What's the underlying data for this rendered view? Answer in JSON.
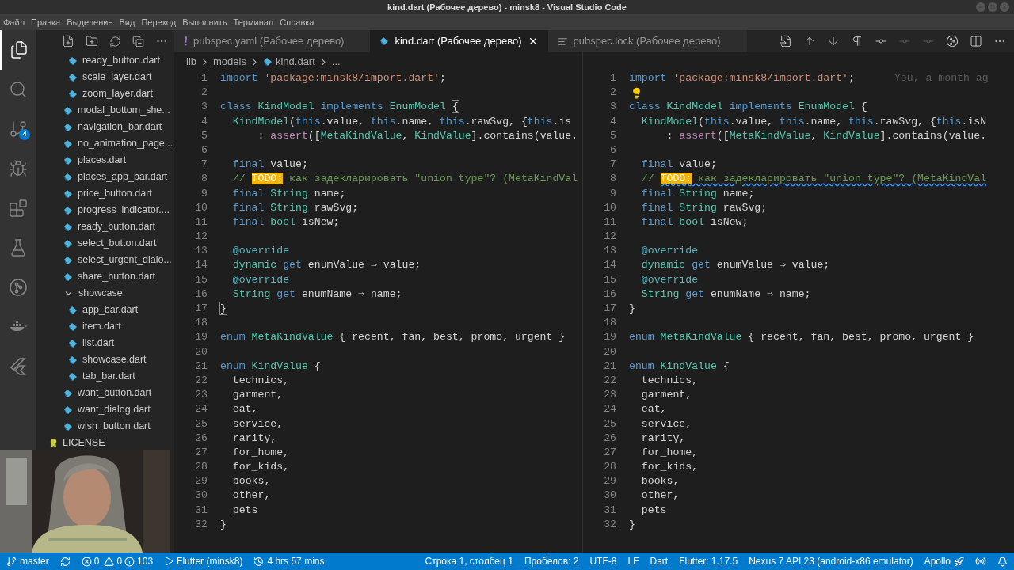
{
  "window": {
    "title": "kind.dart (Рабочее дерево) - minsk8 - Visual Studio Code"
  },
  "menu": [
    "Файл",
    "Правка",
    "Выделение",
    "Вид",
    "Переход",
    "Выполнить",
    "Терминал",
    "Справка"
  ],
  "activity_bar": [
    {
      "selected": true
    },
    {
      "selected": false
    },
    {
      "selected": false,
      "badge": "4"
    },
    {
      "selected": false
    },
    {
      "selected": false
    },
    {
      "selected": false
    },
    {
      "selected": false
    },
    {
      "selected": false
    },
    {
      "selected": false
    }
  ],
  "explorer": {
    "tree": [
      {
        "kind": "group",
        "children": [
          {
            "kind": "group",
            "children": [
              {
                "name": "ready_button.dart",
                "kind": "dart"
              },
              {
                "name": "scale_layer.dart",
                "kind": "dart"
              },
              {
                "name": "zoom_layer.dart",
                "kind": "dart"
              }
            ]
          },
          {
            "name": "modal_bottom_she...",
            "kind": "dart"
          },
          {
            "name": "navigation_bar.dart",
            "kind": "dart"
          },
          {
            "name": "no_animation_page...",
            "kind": "dart"
          },
          {
            "name": "places.dart",
            "kind": "dart"
          },
          {
            "name": "places_app_bar.dart",
            "kind": "dart"
          },
          {
            "name": "price_button.dart",
            "kind": "dart"
          },
          {
            "name": "progress_indicator....",
            "kind": "dart"
          },
          {
            "name": "ready_button.dart",
            "kind": "dart"
          },
          {
            "name": "select_button.dart",
            "kind": "dart"
          },
          {
            "name": "select_urgent_dialo...",
            "kind": "dart"
          },
          {
            "name": "share_button.dart",
            "kind": "dart"
          },
          {
            "name": "showcase",
            "kind": "folder",
            "expanded": true,
            "children": [
              {
                "name": "app_bar.dart",
                "kind": "dart"
              },
              {
                "name": "item.dart",
                "kind": "dart"
              },
              {
                "name": "list.dart",
                "kind": "dart"
              },
              {
                "name": "showcase.dart",
                "kind": "dart"
              },
              {
                "name": "tab_bar.dart",
                "kind": "dart"
              }
            ]
          },
          {
            "name": "want_button.dart",
            "kind": "dart"
          },
          {
            "name": "want_dialog.dart",
            "kind": "dart"
          },
          {
            "name": "wish_button.dart",
            "kind": "dart"
          }
        ]
      },
      {
        "name": "LICENSE",
        "kind": "license"
      }
    ]
  },
  "tabs": [
    {
      "label": "pubspec.yaml (Рабочее дерево)",
      "kind": "yaml",
      "selected": false
    },
    {
      "label": "kind.dart (Рабочее дерево)",
      "kind": "dart",
      "selected": true
    },
    {
      "label": "pubspec.lock (Рабочее дерево)",
      "kind": "lock",
      "selected": false
    }
  ],
  "editor_actions": [
    {
      "disabled": false
    },
    {
      "disabled": false
    },
    {
      "disabled": false
    },
    {
      "disabled": false
    },
    {
      "disabled": false
    },
    {
      "disabled": true
    },
    {
      "disabled": true
    },
    {
      "disabled": false
    },
    {
      "disabled": false
    },
    {
      "disabled": false
    }
  ],
  "breadcrumb": [
    {
      "kind": "folder",
      "text": "lib"
    },
    {
      "kind": "folder",
      "text": "models"
    },
    {
      "kind": "dart",
      "text": "kind.dart"
    },
    {
      "kind": "more",
      "text": "..."
    }
  ],
  "panes": [
    {
      "lines": [
        {
          "num": "1",
          "tokens": [
            {
              "kind": "kw",
              "text": "import"
            },
            {
              "kind": "str",
              "text": " 'package:minsk8/import.dart'"
            },
            {
              "kind": "plain",
              "text": ";"
            }
          ]
        },
        {
          "num": "2"
        },
        {
          "num": "3",
          "tokens": [
            {
              "kind": "kw",
              "text": "class"
            },
            {
              "kind": "type",
              "text": " KindModel"
            },
            {
              "kind": "kw",
              "text": " implements"
            },
            {
              "kind": "type",
              "text": " EnumModel "
            },
            {
              "kind": "bracket",
              "text": "{"
            }
          ]
        },
        {
          "num": "4",
          "tokens": [
            {
              "kind": "type",
              "text": "  KindModel"
            },
            {
              "kind": "plain",
              "text": "("
            },
            {
              "kind": "kw",
              "text": "this"
            },
            {
              "kind": "plain",
              "text": ".value, "
            },
            {
              "kind": "kw",
              "text": "this"
            },
            {
              "kind": "plain",
              "text": ".name, "
            },
            {
              "kind": "kw",
              "text": "this"
            },
            {
              "kind": "plain",
              "text": ".rawSvg, {"
            },
            {
              "kind": "kw",
              "text": "this"
            },
            {
              "kind": "plain",
              "text": ".is"
            }
          ]
        },
        {
          "num": "5",
          "tokens": [
            {
              "kind": "plain",
              "text": "      : "
            },
            {
              "kind": "fn",
              "text": "assert"
            },
            {
              "kind": "plain",
              "text": "(["
            },
            {
              "kind": "type",
              "text": "MetaKindValue"
            },
            {
              "kind": "plain",
              "text": ", "
            },
            {
              "kind": "type",
              "text": "KindValue"
            },
            {
              "kind": "plain",
              "text": "].contains(value."
            }
          ]
        },
        {
          "num": "6"
        },
        {
          "num": "7",
          "tokens": [
            {
              "kind": "kw",
              "text": "  final"
            },
            {
              "kind": "plain",
              "text": " value;"
            }
          ]
        },
        {
          "num": "8",
          "tokens": [
            {
              "kind": "comment",
              "text": "  // "
            },
            {
              "kind": "todo",
              "text": "TODO:"
            },
            {
              "kind": "comment",
              "text": " как задекларировать \"union type\"? (MetaKindVal"
            }
          ]
        },
        {
          "num": "9",
          "tokens": [
            {
              "kind": "kw",
              "text": "  final"
            },
            {
              "kind": "type",
              "text": " String"
            },
            {
              "kind": "plain",
              "text": " name;"
            }
          ]
        },
        {
          "num": "10",
          "tokens": [
            {
              "kind": "kw",
              "text": "  final"
            },
            {
              "kind": "type",
              "text": " String"
            },
            {
              "kind": "plain",
              "text": " rawSvg;"
            }
          ]
        },
        {
          "num": "11",
          "tokens": [
            {
              "kind": "kw",
              "text": "  final"
            },
            {
              "kind": "type",
              "text": " bool"
            },
            {
              "kind": "plain",
              "text": " isNew;"
            }
          ]
        },
        {
          "num": "12"
        },
        {
          "num": "13",
          "tokens": [
            {
              "kind": "meta",
              "text": "  @override"
            }
          ]
        },
        {
          "num": "14",
          "tokens": [
            {
              "kind": "type",
              "text": "  dynamic"
            },
            {
              "kind": "kw",
              "text": " get"
            },
            {
              "kind": "plain",
              "text": " enumValue ⇒ value;"
            }
          ]
        },
        {
          "num": "15",
          "tokens": [
            {
              "kind": "meta",
              "text": "  @override"
            }
          ]
        },
        {
          "num": "16",
          "tokens": [
            {
              "kind": "type",
              "text": "  String"
            },
            {
              "kind": "kw",
              "text": " get"
            },
            {
              "kind": "plain",
              "text": " enumName ⇒ name;"
            }
          ]
        },
        {
          "num": "17",
          "tokens": [
            {
              "kind": "bracket",
              "text": "}"
            }
          ]
        },
        {
          "num": "18"
        },
        {
          "num": "19",
          "tokens": [
            {
              "kind": "kw",
              "text": "enum"
            },
            {
              "kind": "type",
              "text": " MetaKindValue"
            },
            {
              "kind": "plain",
              "text": " { recent, fan, best, promo, urgent }"
            }
          ]
        },
        {
          "num": "20"
        },
        {
          "num": "21",
          "tokens": [
            {
              "kind": "kw",
              "text": "enum"
            },
            {
              "kind": "type",
              "text": " KindValue"
            },
            {
              "kind": "plain",
              "text": " {"
            }
          ]
        },
        {
          "num": "22",
          "tokens": [
            {
              "kind": "plain",
              "text": "  technics,"
            }
          ]
        },
        {
          "num": "23",
          "tokens": [
            {
              "kind": "plain",
              "text": "  garment,"
            }
          ]
        },
        {
          "num": "24",
          "tokens": [
            {
              "kind": "plain",
              "text": "  eat,"
            }
          ]
        },
        {
          "num": "25",
          "tokens": [
            {
              "kind": "plain",
              "text": "  service,"
            }
          ]
        },
        {
          "num": "26",
          "tokens": [
            {
              "kind": "plain",
              "text": "  rarity,"
            }
          ]
        },
        {
          "num": "27",
          "tokens": [
            {
              "kind": "plain",
              "text": "  for_home,"
            }
          ]
        },
        {
          "num": "28",
          "tokens": [
            {
              "kind": "plain",
              "text": "  for_kids,"
            }
          ]
        },
        {
          "num": "29",
          "tokens": [
            {
              "kind": "plain",
              "text": "  books,"
            }
          ]
        },
        {
          "num": "30",
          "tokens": [
            {
              "kind": "plain",
              "text": "  other,"
            }
          ]
        },
        {
          "num": "31",
          "tokens": [
            {
              "kind": "plain",
              "text": "  pets"
            }
          ]
        },
        {
          "num": "32",
          "tokens": [
            {
              "kind": "plain",
              "text": "}"
            }
          ]
        }
      ]
    },
    {
      "lines": [
        {
          "num": "1",
          "tokens": [
            {
              "kind": "kw",
              "text": "import"
            },
            {
              "kind": "str",
              "text": " 'package:minsk8/import.dart'"
            },
            {
              "kind": "plain",
              "text": ";"
            }
          ],
          "blame": "You, a month ag"
        },
        {
          "num": "2",
          "tokens": [
            {
              "kind": "lightbulb"
            }
          ]
        },
        {
          "num": "3",
          "tokens": [
            {
              "kind": "kw",
              "text": "class"
            },
            {
              "kind": "type",
              "text": " KindModel"
            },
            {
              "kind": "kw",
              "text": " implements"
            },
            {
              "kind": "type",
              "text": " EnumModel"
            },
            {
              "kind": "plain",
              "text": " {"
            }
          ]
        },
        {
          "num": "4",
          "tokens": [
            {
              "kind": "type",
              "text": "  KindModel"
            },
            {
              "kind": "plain",
              "text": "("
            },
            {
              "kind": "kw",
              "text": "this"
            },
            {
              "kind": "plain",
              "text": ".value, "
            },
            {
              "kind": "kw",
              "text": "this"
            },
            {
              "kind": "plain",
              "text": ".name, "
            },
            {
              "kind": "kw",
              "text": "this"
            },
            {
              "kind": "plain",
              "text": ".rawSvg, {"
            },
            {
              "kind": "kw",
              "text": "this"
            },
            {
              "kind": "plain",
              "text": ".isN"
            }
          ]
        },
        {
          "num": "5",
          "tokens": [
            {
              "kind": "plain",
              "text": "      : "
            },
            {
              "kind": "fn",
              "text": "assert"
            },
            {
              "kind": "plain",
              "text": "(["
            },
            {
              "kind": "type",
              "text": "MetaKindValue"
            },
            {
              "kind": "plain",
              "text": ", "
            },
            {
              "kind": "type",
              "text": "KindValue"
            },
            {
              "kind": "plain",
              "text": "].contains(value."
            }
          ]
        },
        {
          "num": "6"
        },
        {
          "num": "7",
          "tokens": [
            {
              "kind": "kw",
              "text": "  final"
            },
            {
              "kind": "plain",
              "text": " value;"
            }
          ]
        },
        {
          "num": "8",
          "tokens": [
            {
              "kind": "comment",
              "text": "  // "
            },
            {
              "kind": "todo_squiggle",
              "text": "TODO:"
            },
            {
              "kind": "comment_squiggle",
              "text": " как задекларировать \"union type\"? (MetaKindVal"
            }
          ]
        },
        {
          "num": "9",
          "tokens": [
            {
              "kind": "kw",
              "text": "  final"
            },
            {
              "kind": "type",
              "text": " String"
            },
            {
              "kind": "plain",
              "text": " name;"
            }
          ]
        },
        {
          "num": "10",
          "tokens": [
            {
              "kind": "kw",
              "text": "  final"
            },
            {
              "kind": "type",
              "text": " String"
            },
            {
              "kind": "plain",
              "text": " rawSvg;"
            }
          ]
        },
        {
          "num": "11",
          "tokens": [
            {
              "kind": "kw",
              "text": "  final"
            },
            {
              "kind": "type",
              "text": " bool"
            },
            {
              "kind": "plain",
              "text": " isNew;"
            }
          ]
        },
        {
          "num": "12"
        },
        {
          "num": "13",
          "tokens": [
            {
              "kind": "meta",
              "text": "  @override"
            }
          ]
        },
        {
          "num": "14",
          "tokens": [
            {
              "kind": "type",
              "text": "  dynamic"
            },
            {
              "kind": "kw",
              "text": " get"
            },
            {
              "kind": "plain",
              "text": " enumValue ⇒ value;"
            }
          ]
        },
        {
          "num": "15",
          "tokens": [
            {
              "kind": "meta",
              "text": "  @override"
            }
          ]
        },
        {
          "num": "16",
          "tokens": [
            {
              "kind": "type",
              "text": "  String"
            },
            {
              "kind": "kw",
              "text": " get"
            },
            {
              "kind": "plain",
              "text": " enumName ⇒ name;"
            }
          ]
        },
        {
          "num": "17",
          "tokens": [
            {
              "kind": "plain",
              "text": "}"
            }
          ]
        },
        {
          "num": "18"
        },
        {
          "num": "19",
          "tokens": [
            {
              "kind": "kw",
              "text": "enum"
            },
            {
              "kind": "type",
              "text": " MetaKindValue"
            },
            {
              "kind": "plain",
              "text": " { recent, fan, best, promo, urgent }"
            }
          ]
        },
        {
          "num": "20"
        },
        {
          "num": "21",
          "tokens": [
            {
              "kind": "kw",
              "text": "enum"
            },
            {
              "kind": "type",
              "text": " KindValue"
            },
            {
              "kind": "plain",
              "text": " {"
            }
          ]
        },
        {
          "num": "22",
          "tokens": [
            {
              "kind": "plain",
              "text": "  technics,"
            }
          ]
        },
        {
          "num": "23",
          "tokens": [
            {
              "kind": "plain",
              "text": "  garment,"
            }
          ]
        },
        {
          "num": "24",
          "tokens": [
            {
              "kind": "plain",
              "text": "  eat,"
            }
          ]
        },
        {
          "num": "25",
          "tokens": [
            {
              "kind": "plain",
              "text": "  service,"
            }
          ]
        },
        {
          "num": "26",
          "tokens": [
            {
              "kind": "plain",
              "text": "  rarity,"
            }
          ]
        },
        {
          "num": "27",
          "tokens": [
            {
              "kind": "plain",
              "text": "  for_home,"
            }
          ]
        },
        {
          "num": "28",
          "tokens": [
            {
              "kind": "plain",
              "text": "  for_kids,"
            }
          ]
        },
        {
          "num": "29",
          "tokens": [
            {
              "kind": "plain",
              "text": "  books,"
            }
          ]
        },
        {
          "num": "30",
          "tokens": [
            {
              "kind": "plain",
              "text": "  other,"
            }
          ]
        },
        {
          "num": "31",
          "tokens": [
            {
              "kind": "plain",
              "text": "  pets"
            }
          ]
        },
        {
          "num": "32",
          "tokens": [
            {
              "kind": "plain",
              "text": "}"
            }
          ]
        }
      ]
    }
  ],
  "webcam": {
    "kind": "picture"
  },
  "status_bar": {
    "left": [
      {
        "kind": "branch",
        "text": "master"
      },
      {
        "kind": "sync"
      },
      {
        "kind": "problems",
        "errors": "0",
        "warnings": "0",
        "infos": "103"
      },
      {
        "kind": "run",
        "text": "Flutter (minsk8)"
      },
      {
        "kind": "timer",
        "text": "4 hrs 57 mins"
      }
    ],
    "right": [
      {
        "kind": "text",
        "text": "Строка 1, столбец 1"
      },
      {
        "kind": "text",
        "text": "Пробелов: 2"
      },
      {
        "kind": "text",
        "text": "UTF-8"
      },
      {
        "kind": "text",
        "text": "LF"
      },
      {
        "kind": "text",
        "text": "Dart"
      },
      {
        "kind": "text",
        "text": "Flutter: 1.17.5"
      },
      {
        "kind": "text",
        "text": "Nexus 7 API 23 (android-x86 emulator)"
      },
      {
        "kind": "rocket",
        "text": "Apollo"
      },
      {
        "kind": "broadcast"
      },
      {
        "kind": "bell"
      }
    ]
  }
}
